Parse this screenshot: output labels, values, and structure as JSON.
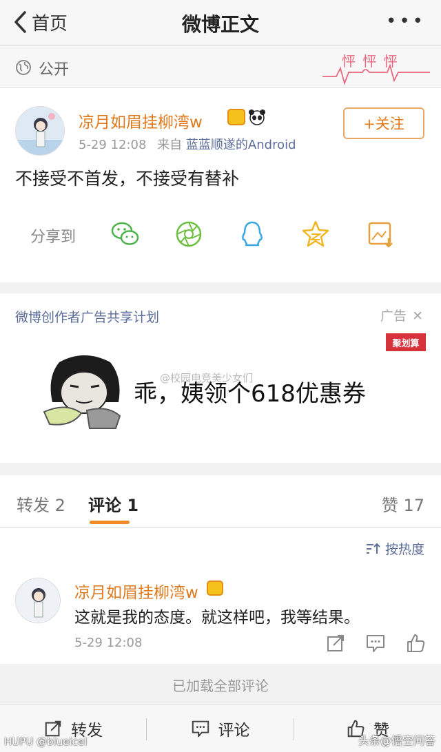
{
  "nav": {
    "back_label": "首页",
    "title": "微博正文",
    "more": "•••"
  },
  "visibility": {
    "label": "公开",
    "sticker_text": "怦 怦 怦"
  },
  "post": {
    "author": "凉月如眉挂柳湾w",
    "time": "5-29 12:08",
    "source_prefix": "来自",
    "source": "蓝蓝顺遂的Android",
    "follow_label": "+关注",
    "text": "不接受不首发，不接受有替补",
    "share_label": "分享到",
    "share_targets": [
      "wechat-icon",
      "moments-icon",
      "qq-icon",
      "qzone-icon",
      "save-image-icon"
    ]
  },
  "ad": {
    "plan_label": "微博创作者广告共享计划",
    "ad_tag": "广告",
    "brand": "聚划算",
    "slogan": "乖，姨领个618优惠券",
    "watermark": "@校园电竞美少女们"
  },
  "tabs": {
    "repost": "转发 2",
    "comment": "评论 1",
    "like": "赞 17"
  },
  "comments": {
    "sort_label": "按热度",
    "items": [
      {
        "author": "凉月如眉挂柳湾w",
        "text": "这就是我的态度。就这样吧，我等结果。",
        "time": "5-29 12:08"
      }
    ],
    "loaded_all": "已加载全部评论"
  },
  "bottom_bar": {
    "repost": "转发",
    "comment": "评论",
    "like": "赞"
  },
  "watermarks": {
    "left": "HUPU @blueicel",
    "right": "头条@悟空问答"
  },
  "colors": {
    "accent": "#e07a1e",
    "link": "#5b6d98",
    "tab_indicator": "#f08a24"
  }
}
